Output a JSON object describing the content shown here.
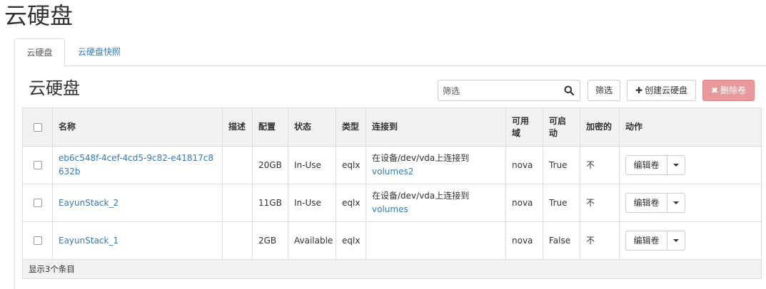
{
  "page": {
    "title": "云硬盘"
  },
  "tabs": [
    {
      "label": "云硬盘",
      "active": true
    },
    {
      "label": "云硬盘快照",
      "active": false
    }
  ],
  "section": {
    "title": "云硬盘"
  },
  "toolbar": {
    "filter_value": "筛选",
    "filter_button": "筛选",
    "create_button": "创建云硬盘",
    "delete_button": "删除卷"
  },
  "table": {
    "headers": {
      "name": "名称",
      "desc": "描述",
      "size": "配置",
      "status": "状态",
      "type": "类型",
      "attached": "连接到",
      "zone": "可用域",
      "bootable": "可启动",
      "encrypted": "加密的",
      "actions": "动作"
    },
    "rows": [
      {
        "name": "eb6c548f-4cef-4cd5-9c82-e41817c8632b",
        "desc": "",
        "size": "20GB",
        "status": "In-Use",
        "type": "eqlx",
        "attached_prefix": "在设备/dev/vda上连接到",
        "attached_link": "volumes2",
        "zone": "nova",
        "bootable": "True",
        "encrypted": "不",
        "action": "编辑卷"
      },
      {
        "name": "EayunStack_2",
        "desc": "",
        "size": "11GB",
        "status": "In-Use",
        "type": "eqlx",
        "attached_prefix": "在设备/dev/vda上连接到",
        "attached_link": "volumes",
        "zone": "nova",
        "bootable": "True",
        "encrypted": "不",
        "action": "编辑卷"
      },
      {
        "name": "EayunStack_1",
        "desc": "",
        "size": "2GB",
        "status": "Available",
        "type": "eqlx",
        "attached_prefix": "",
        "attached_link": "",
        "zone": "nova",
        "bootable": "False",
        "encrypted": "不",
        "action": "编辑卷"
      }
    ],
    "footer": "显示3个条目"
  }
}
